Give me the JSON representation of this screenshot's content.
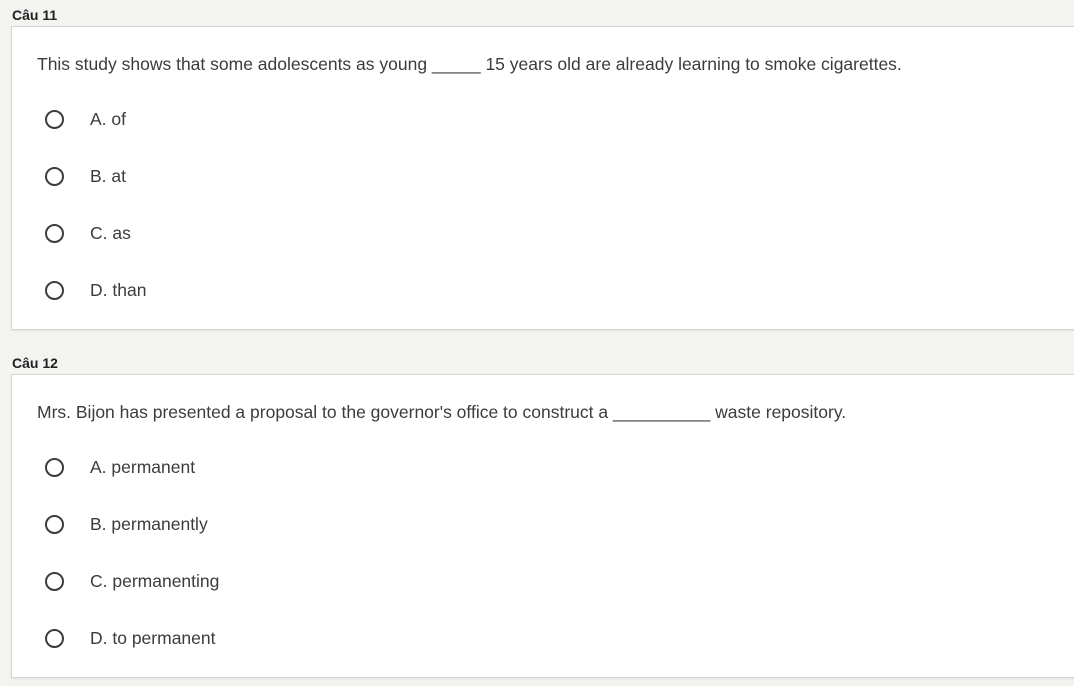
{
  "questions": [
    {
      "label": "Câu 11",
      "text": "This study shows that some adolescents as young _____ 15 years old are already learning to smoke cigarettes.",
      "options": [
        "A. of",
        "B. at",
        "C. as",
        "D. than"
      ]
    },
    {
      "label": "Câu 12",
      "text": "Mrs. Bijon has presented a proposal to the governor's office to construct a __________ waste repository.",
      "options": [
        "A. permanent",
        "B. permanently",
        "C. permanenting",
        "D. to permanent"
      ]
    }
  ]
}
